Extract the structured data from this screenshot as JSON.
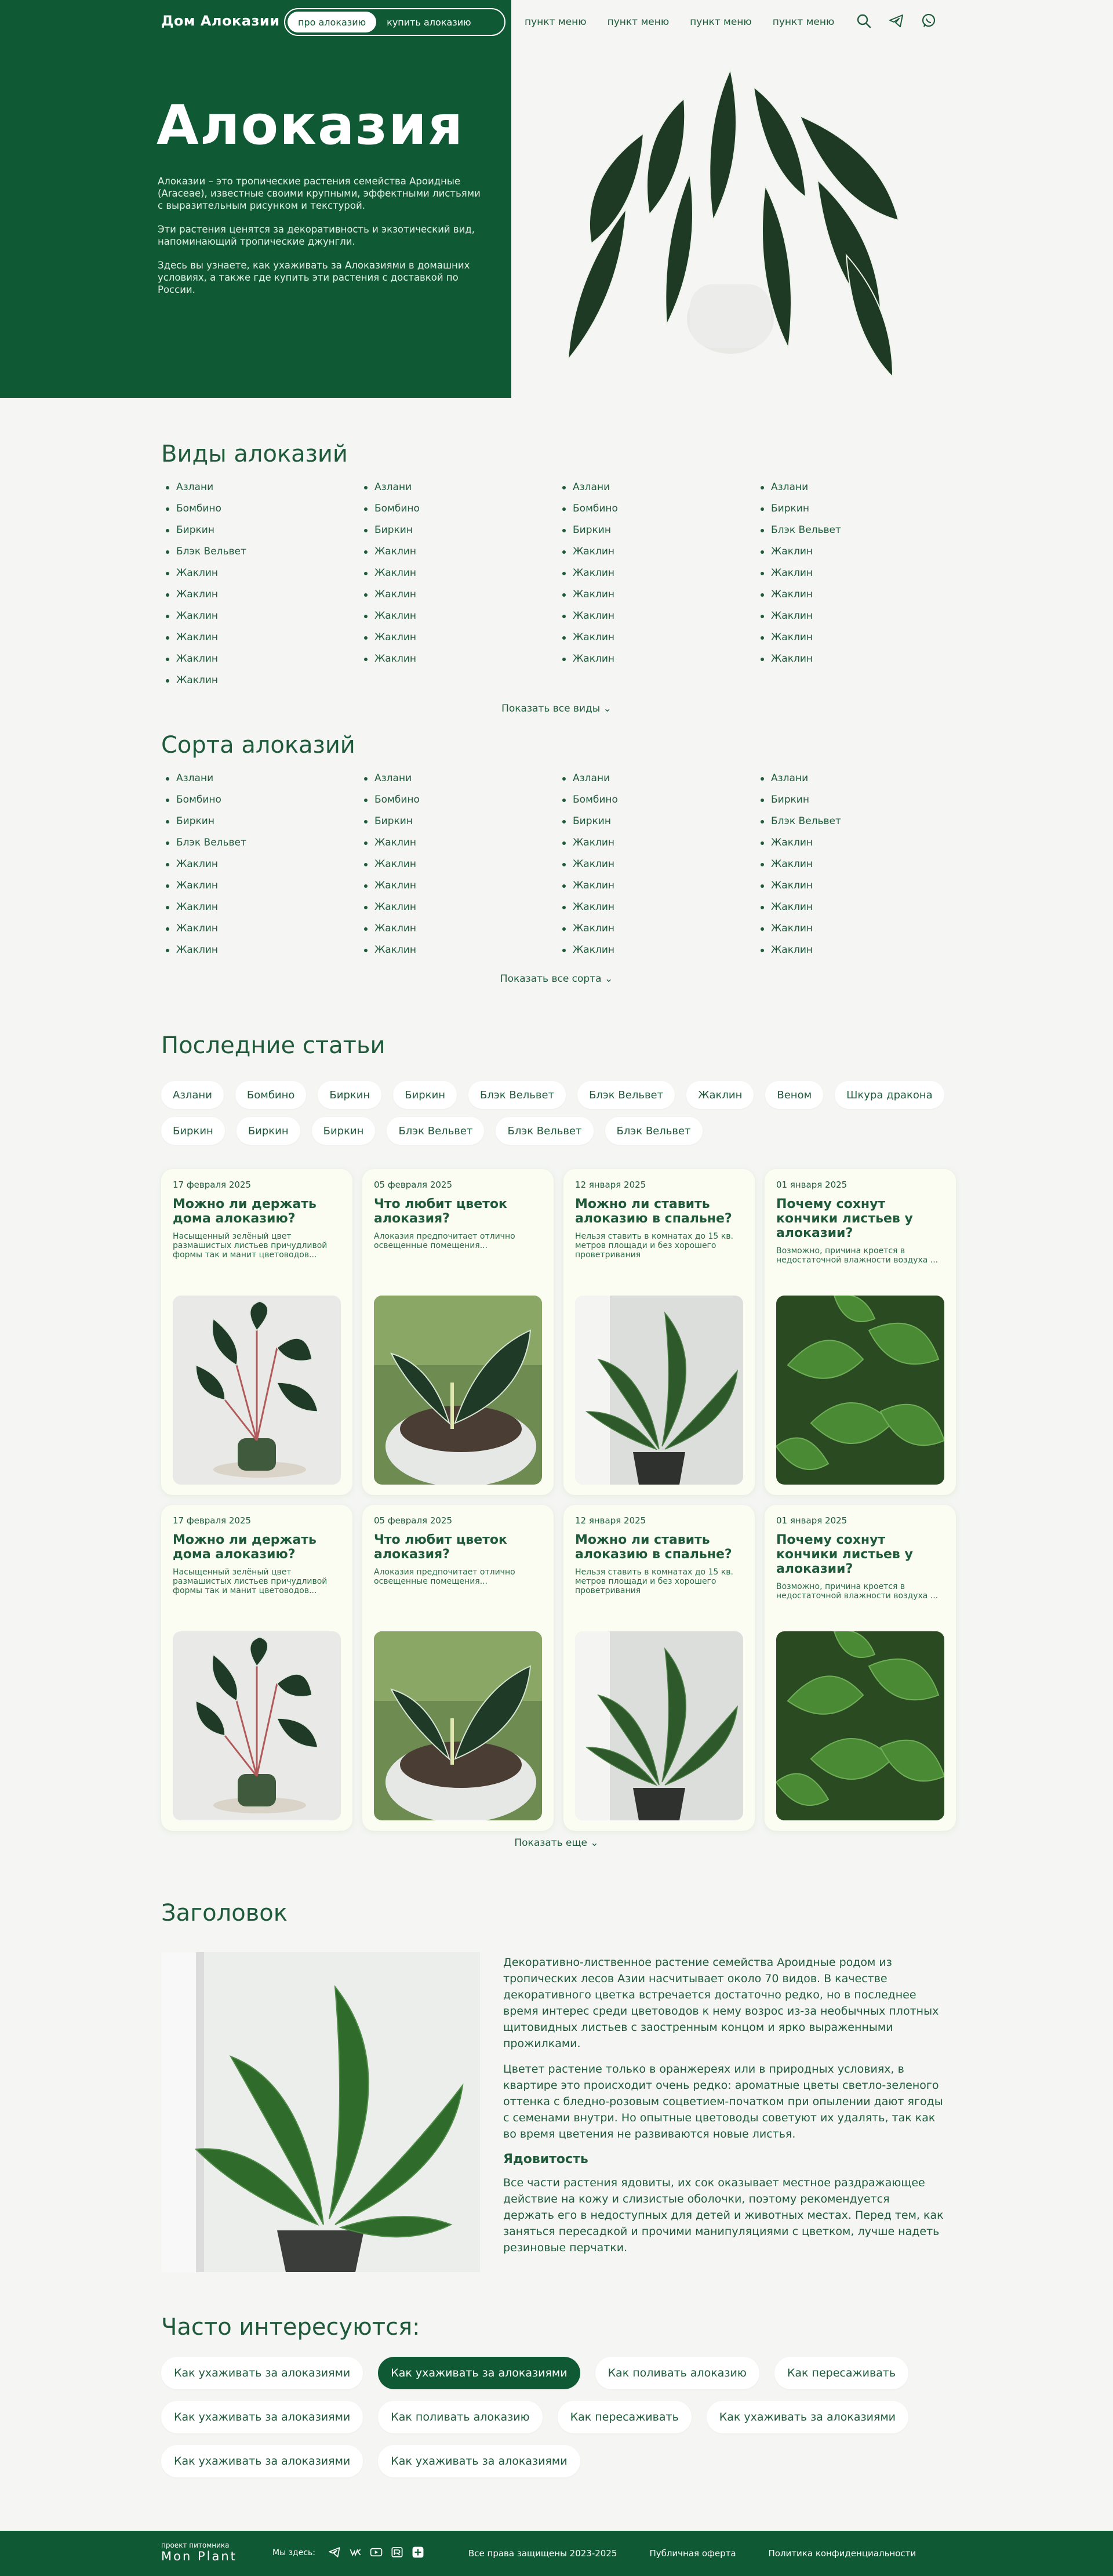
{
  "header": {
    "brand": "Дом Алоказии",
    "tabs": [
      "про алоказию",
      "купить алоказию"
    ],
    "menu": [
      "пункт меню",
      "пункт меню",
      "пункт меню",
      "пункт меню"
    ],
    "icons": [
      "search-icon",
      "telegram-icon",
      "whatsapp-icon"
    ]
  },
  "hero": {
    "title": "Алоказия",
    "paragraphs": [
      "Алоказии – это тропические растения семейства Ароидные (Araceae), известные своими крупными, эффектными листьями с выразительным рисунком и текстурой.",
      "Эти растения ценятся за декоративность и экзотический вид, напоминающий тропические джунгли.",
      "Здесь вы узнаете, как ухаживать за Алоказиями в домашних условиях, а также где купить эти растения с доставкой по России."
    ]
  },
  "species": {
    "title": "Виды алоказий",
    "columns": [
      [
        "Азлани",
        "Бомбино",
        "Биркин",
        "Блэк Вельвет",
        "Жаклин",
        "Жаклин",
        "Жаклин",
        "Жаклин",
        "Жаклин",
        "Жаклин"
      ],
      [
        "Азлани",
        "Бомбино",
        "Биркин",
        "Жаклин",
        "Жаклин",
        "Жаклин",
        "Жаклин",
        "Жаклин",
        "Жаклин"
      ],
      [
        "Азлани",
        "Бомбино",
        "Биркин",
        "Жаклин",
        "Жаклин",
        "Жаклин",
        "Жаклин",
        "Жаклин",
        "Жаклин"
      ],
      [
        "Азлани",
        "Биркин",
        "Блэк Вельвет",
        "Жаклин",
        "Жаклин",
        "Жаклин",
        "Жаклин",
        "Жаклин",
        "Жаклин"
      ]
    ],
    "show_all": "Показать все виды"
  },
  "varieties": {
    "title": "Сорта алоказий",
    "columns": [
      [
        "Азлани",
        "Бомбино",
        "Биркин",
        "Блэк Вельвет",
        "Жаклин",
        "Жаклин",
        "Жаклин",
        "Жаклин",
        "Жаклин"
      ],
      [
        "Азлани",
        "Бомбино",
        "Биркин",
        "Жаклин",
        "Жаклин",
        "Жаклин",
        "Жаклин",
        "Жаклин",
        "Жаклин"
      ],
      [
        "Азлани",
        "Бомбино",
        "Биркин",
        "Жаклин",
        "Жаклин",
        "Жаклин",
        "Жаклин",
        "Жаклин",
        "Жаклин"
      ],
      [
        "Азлани",
        "Биркин",
        "Блэк Вельвет",
        "Жаклин",
        "Жаклин",
        "Жаклин",
        "Жаклин",
        "Жаклин",
        "Жаклин"
      ]
    ],
    "show_all": "Показать все сорта"
  },
  "articles": {
    "title": "Последние статьи",
    "tags": [
      "Азлани",
      "Бомбино",
      "Биркин",
      "Биркин",
      "Блэк Вельвет",
      "Блэк Вельвет",
      "Жаклин",
      "Веном",
      "Шкура дракона",
      "Биркин",
      "Биркин",
      "Биркин",
      "Блэк Вельвет",
      "Блэк Вельвет",
      "Блэк Вельвет"
    ],
    "cards": [
      {
        "date": "17 февраля 2025",
        "title": "Можно ли держать дома алоказию?",
        "desc": "Насыщенный зелёный цвет размашистых листьев причудливой формы так и манит цветоводов..."
      },
      {
        "date": "05 февраля 2025",
        "title": "Что любит цветок алоказия?",
        "desc": "Алоказия предпочитает отлично освещенные помещения..."
      },
      {
        "date": "12 января 2025",
        "title": "Можно ли ставить алоказию в спальне?",
        "desc": "Нельзя ставить в комнатах до 15 кв. метров площади и без хорошего проветривания"
      },
      {
        "date": "01 января 2025",
        "title": "Почему сохнут кончики листьев у алоказии?",
        "desc": "Возможно, причина кроется в недостаточной влажности воздуха ..."
      },
      {
        "date": "17 февраля 2025",
        "title": "Можно ли держать дома алоказию?",
        "desc": "Насыщенный зелёный цвет размашистых листьев причудливой формы так и манит цветоводов..."
      },
      {
        "date": "05 февраля 2025",
        "title": "Что любит цветок алоказия?",
        "desc": "Алоказия предпочитает отлично освещенные помещения..."
      },
      {
        "date": "12 января 2025",
        "title": "Можно ли ставить алоказию в спальне?",
        "desc": "Нельзя ставить в комнатах до 15 кв. метров площади и без хорошего проветривания"
      },
      {
        "date": "01 января 2025",
        "title": "Почему сохнут кончики листьев у алоказии?",
        "desc": "Возможно, причина кроется в недостаточной влажности воздуха ..."
      }
    ],
    "show_more": "Показать еще"
  },
  "headline": {
    "title": "Заголовок",
    "p1": "Декоративно-лиственное растение семейства Ароидные родом из тропических лесов Азии насчитывает около 70 видов. В качестве декоративного цветка встречается достаточно редко, но в последнее время интерес среди цветоводов к нему возрос из-за необычных плотных щитовидных листьев с заостренным концом и ярко выраженными прожилками.",
    "p2": "Цветет растение только в оранжереях или в природных условиях, в квартире это происходит очень редко: ароматные цветы светло-зеленого оттенка с бледно-розовым соцветием-початком при опылении дают ягоды с семенами внутри. Но опытные цветоводы советуют их удалять, так как во время цветения не развиваются новые листья.",
    "subtitle": "Ядовитость",
    "p3": "Все части растения ядовиты, их сок оказывает местное раздражающее действие на кожу и слизистые оболочки, поэтому рекомендуется держать его в недоступных для детей и животных местах. Перед тем, как заняться пересадкой и прочими манипуляциями с цветком, лучше надеть резиновые перчатки."
  },
  "faq": {
    "title": "Часто интересуются:",
    "items": [
      "Как ухаживать за алоказиями",
      "Как ухаживать за алоказиями",
      "Как поливать алоказию",
      "Как пересаживать",
      "Как ухаживать за алоказиями",
      "Как поливать алоказию",
      "Как пересаживать",
      "Как ухаживать за алоказиями",
      "Как ухаживать за алоказиями",
      "Как ухаживать за алоказиями"
    ]
  },
  "footer": {
    "brand_small": "проект питомника",
    "brand_name": "Mon Plant",
    "we_are": "Мы здесь:",
    "icons": [
      "telegram-icon",
      "vk-icon",
      "youtube-icon",
      "rutube-icon",
      "plus-icon"
    ],
    "rights": "Все права защищены 2023-2025",
    "offer": "Публичная оферта",
    "privacy": "Политика конфиденциальности"
  },
  "colors": {
    "brand_green": "#0f5a34",
    "text_green": "#1f5a3b",
    "background": "#f5f6f4",
    "card_bg": "#fbfdf3"
  }
}
